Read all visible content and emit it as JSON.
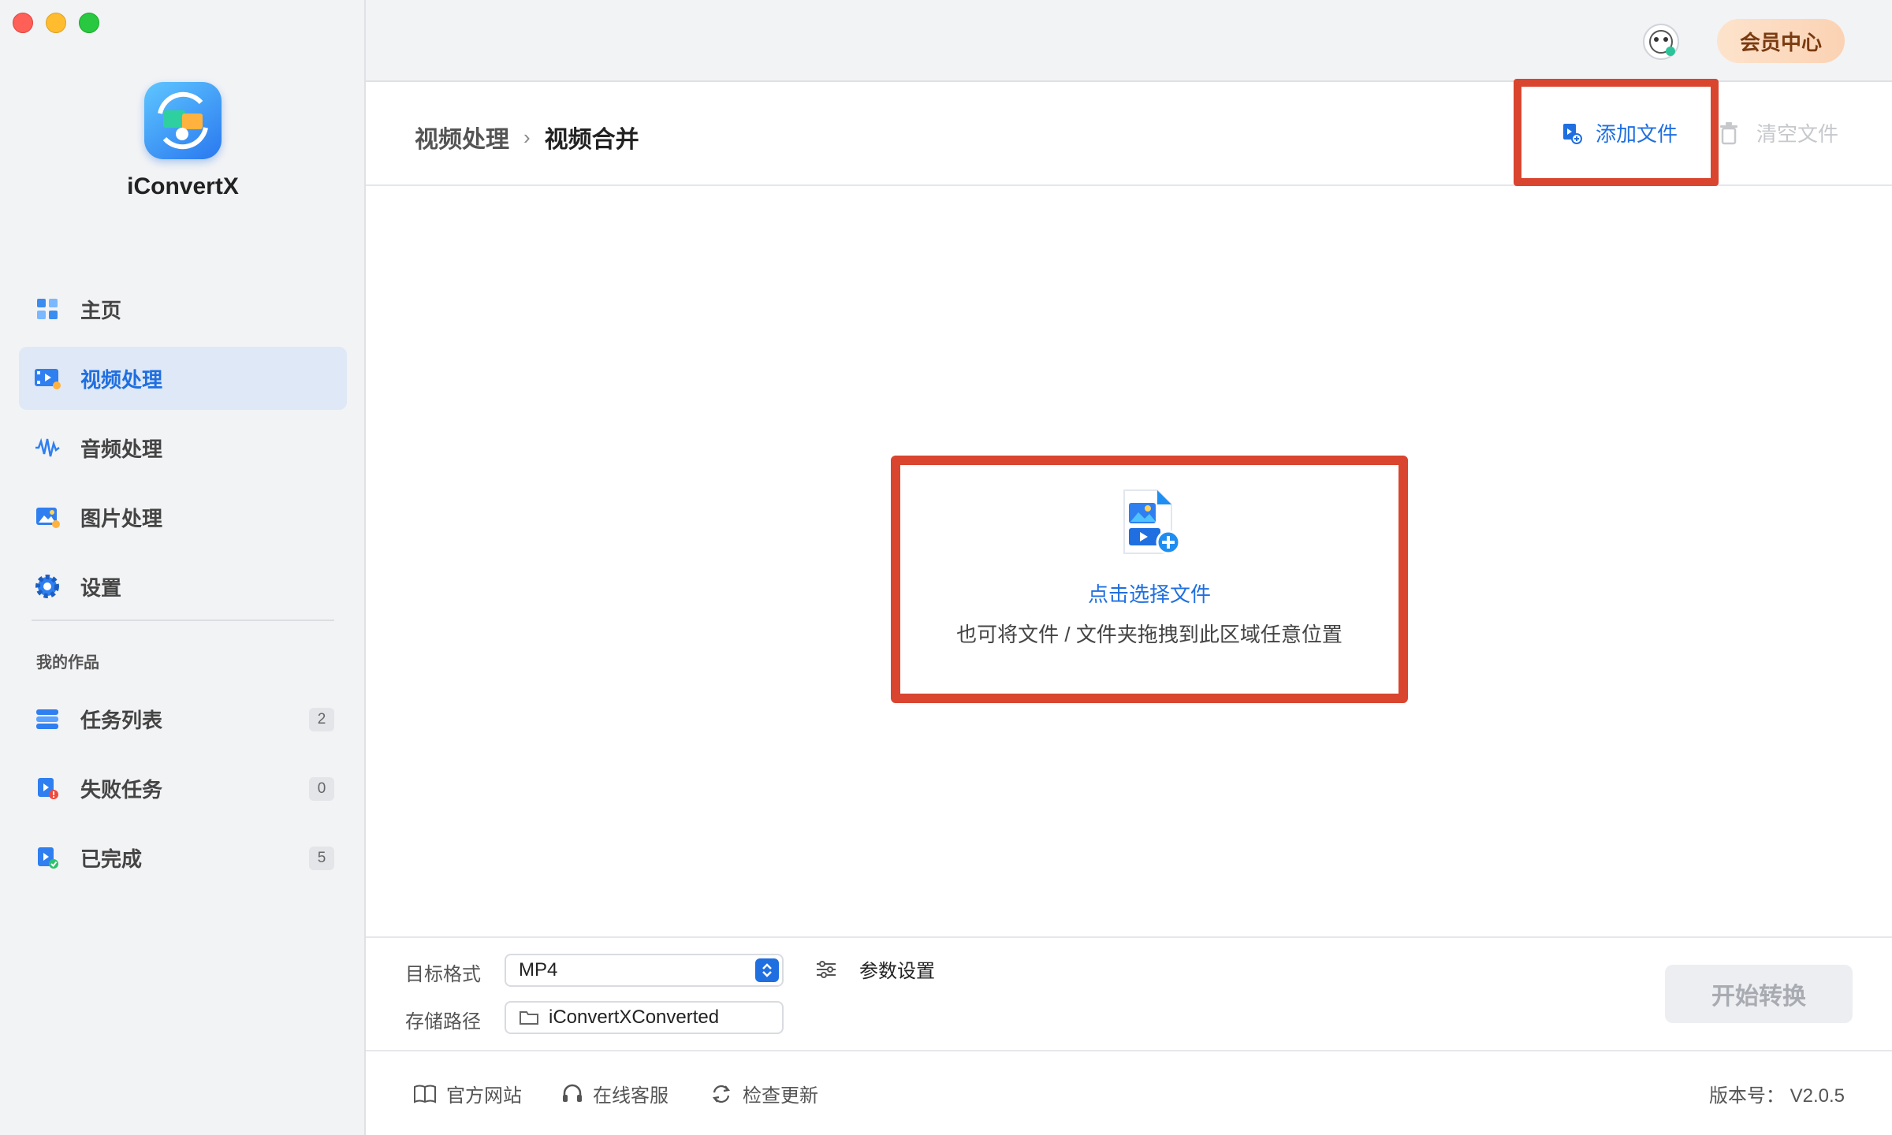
{
  "app": {
    "name": "iConvertX"
  },
  "topbar": {
    "member_label": "会员中心"
  },
  "sidebar": {
    "items": [
      {
        "label": "主页"
      },
      {
        "label": "视频处理"
      },
      {
        "label": "音频处理"
      },
      {
        "label": "图片处理"
      },
      {
        "label": "设置"
      }
    ],
    "section_label": "我的作品",
    "works": [
      {
        "label": "任务列表",
        "count": "2"
      },
      {
        "label": "失败任务",
        "count": "0"
      },
      {
        "label": "已完成",
        "count": "5"
      }
    ]
  },
  "header": {
    "breadcrumb_parent": "视频处理",
    "breadcrumb_separator": "›",
    "breadcrumb_current": "视频合并",
    "add_file_label": "添加文件",
    "clear_file_label": "清空文件"
  },
  "dropzone": {
    "title": "点击选择文件",
    "subtitle": "也可将文件 / 文件夹拖拽到此区域任意位置"
  },
  "settings": {
    "format_label": "目标格式",
    "format_value": "MP4",
    "path_label": "存储路径",
    "path_value": "iConvertXConverted",
    "param_label": "参数设置",
    "start_label": "开始转换"
  },
  "footer": {
    "website_label": "官方网站",
    "support_label": "在线客服",
    "update_label": "检查更新",
    "version_text": "版本号： V2.0.5"
  },
  "colors": {
    "accent": "#1f6fe0",
    "highlight": "#d9452f",
    "sidebar_bg": "#f2f3f5",
    "active_item_bg": "#dfe8f6"
  }
}
